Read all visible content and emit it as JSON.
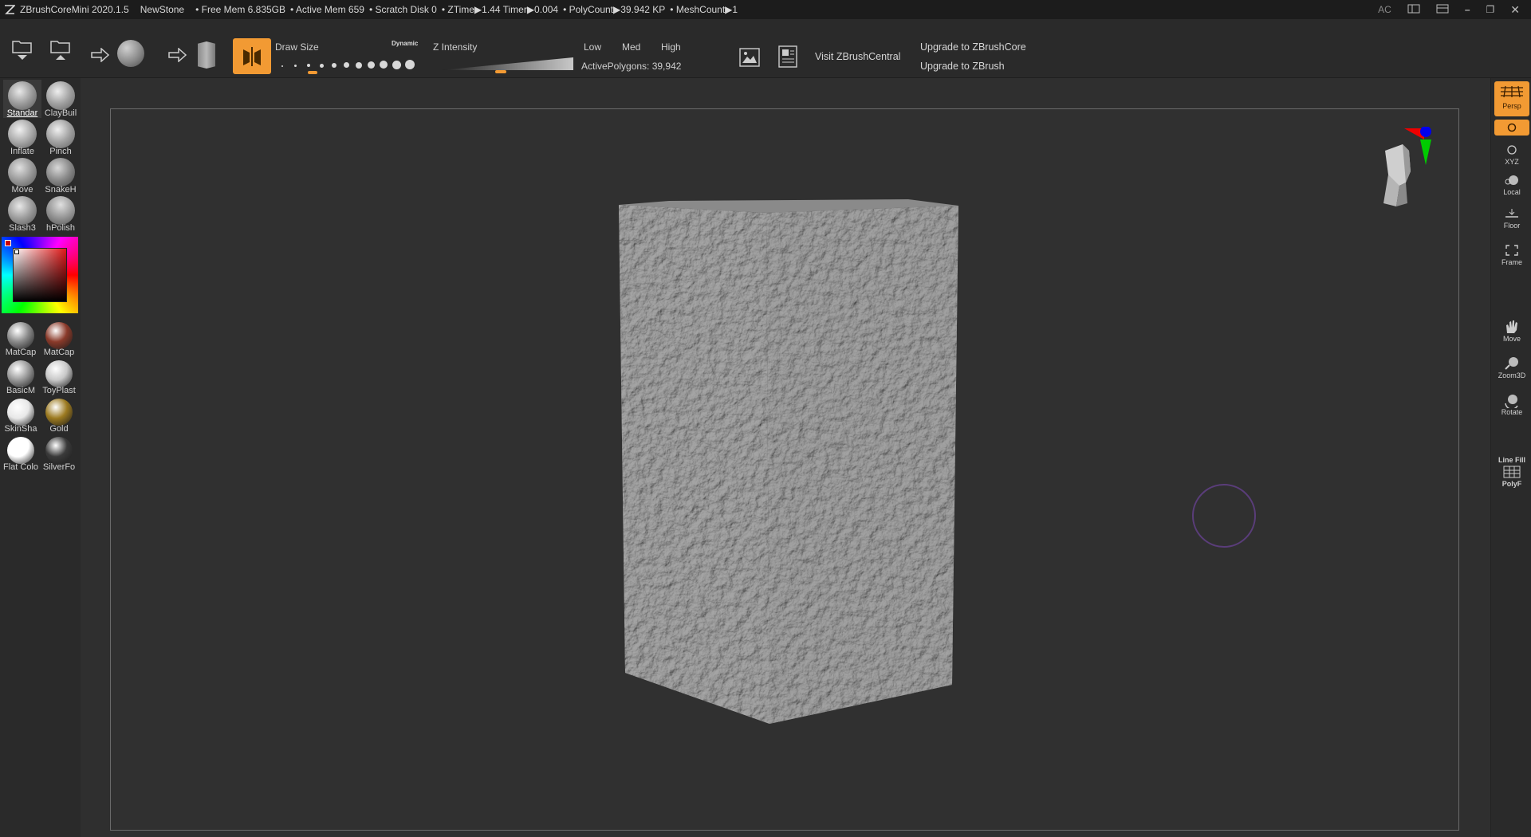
{
  "titlebar": {
    "app_name": "ZBrushCoreMini 2020.1.5",
    "document": "NewStone",
    "free_mem": "• Free Mem 6.835GB",
    "active_mem": "• Active Mem 659",
    "scratch_disk": "• Scratch Disk 0",
    "ztime": "• ZTime▶1.44 Timer▶0.004",
    "polycount": "• PolyCount▶39.942 KP",
    "meshcount": "• MeshCount▶1",
    "ac": "AC"
  },
  "toolbar": {
    "draw_size_label": "Draw Size",
    "dynamic_label": "Dynamic",
    "z_intensity_label": "Z Intensity",
    "low": "Low",
    "med": "Med",
    "high": "High",
    "active_polygons": "ActivePolygons: 39,942",
    "visit_central": "Visit ZBrushCentral",
    "upgrade_core": "Upgrade to ZBrushCore",
    "upgrade_zbrush": "Upgrade to ZBrush",
    "draw_size_level": 3,
    "z_intensity_value": 0.45
  },
  "brushes": [
    {
      "label": "Standar",
      "selected": true
    },
    {
      "label": "ClayBuil"
    },
    {
      "label": "Inflate"
    },
    {
      "label": "Pinch"
    },
    {
      "label": "Move"
    },
    {
      "label": "SnakeH"
    },
    {
      "label": "Slash3"
    },
    {
      "label": "hPolish"
    }
  ],
  "materials": [
    {
      "label": "MatCap",
      "color": "#8a8a8a"
    },
    {
      "label": "MatCap",
      "color": "#8a3a2a"
    },
    {
      "label": "BasicM",
      "color": "#9a9a9a"
    },
    {
      "label": "ToyPlast",
      "color": "#c8c8c8"
    },
    {
      "label": "SkinSha",
      "color": "#e8e8e8"
    },
    {
      "label": "Gold",
      "color": "#9c7a20"
    },
    {
      "label": "Flat Colo",
      "color": "#ffffff"
    },
    {
      "label": "SilverFo",
      "color": "#3a3a3a"
    }
  ],
  "rightshelf": {
    "persp": "Persp",
    "xyz": "XYZ",
    "local": "Local",
    "floor": "Floor",
    "frame": "Frame",
    "move": "Move",
    "zoom3d": "Zoom3D",
    "rotate": "Rotate",
    "linefill": "Line Fill",
    "polyf": "PolyF"
  },
  "colors": {
    "accent": "#f29a33",
    "bg": "#2f2f2f",
    "titlebar": "#1c1c1c"
  }
}
